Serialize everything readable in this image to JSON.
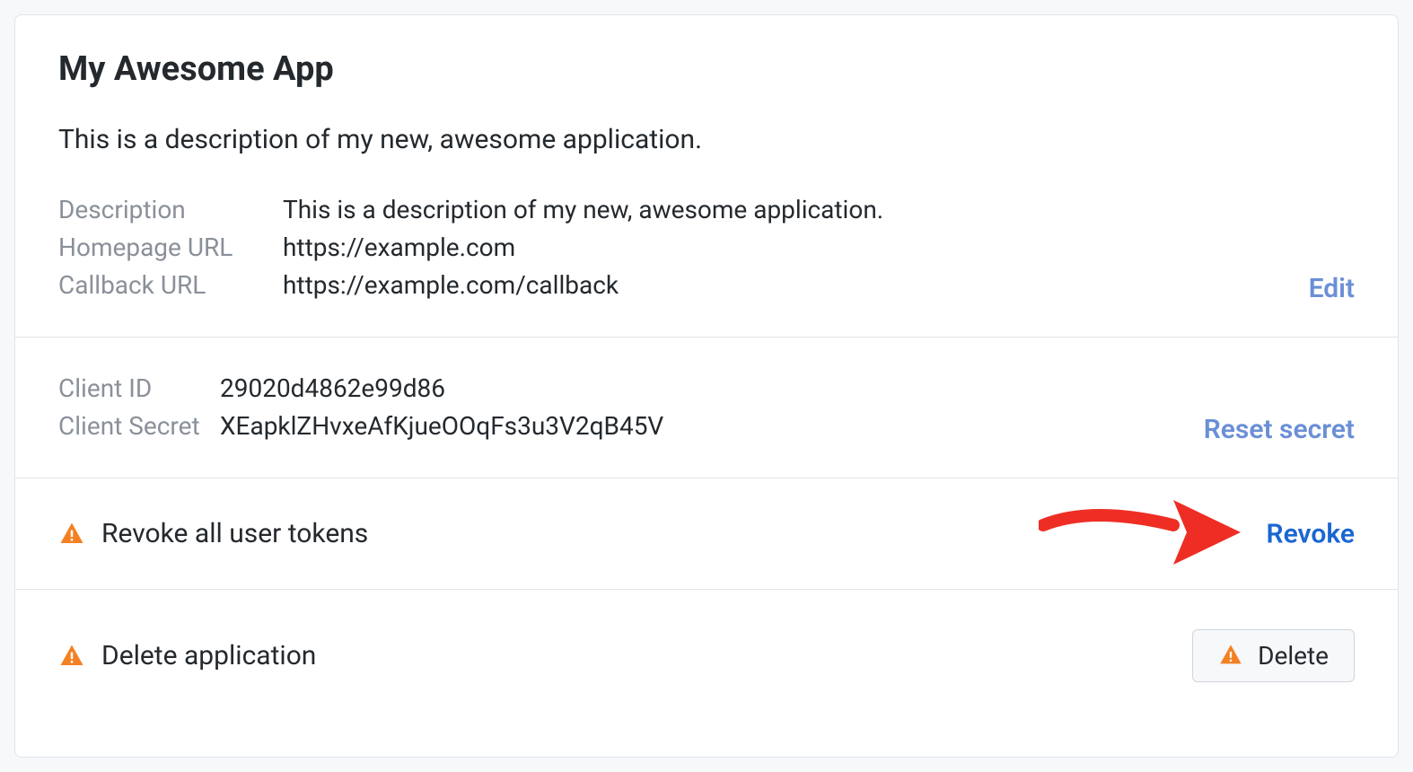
{
  "app": {
    "title": "My Awesome App",
    "description": "This is a description of my new, awesome application."
  },
  "details": {
    "description_label": "Description",
    "description_value": "This is a description of my new, awesome application.",
    "homepage_label": "Homepage URL",
    "homepage_value": "https://example.com",
    "callback_label": "Callback URL",
    "callback_value": "https://example.com/callback",
    "edit_label": "Edit"
  },
  "credentials": {
    "client_id_label": "Client ID",
    "client_id_value": "29020d4862e99d86",
    "client_secret_label": "Client Secret",
    "client_secret_value": "XEapklZHvxeAfKjueOOqFs3u3V2qB45V",
    "reset_label": "Reset secret"
  },
  "revoke": {
    "label": "Revoke all user tokens",
    "action_label": "Revoke"
  },
  "delete": {
    "label": "Delete application",
    "button_label": "Delete"
  },
  "colors": {
    "link_muted": "#6a8fd6",
    "link_primary": "#1a67d2",
    "warning": "#f48022",
    "annotation_arrow": "#ee2e24"
  },
  "icons": {
    "warning": "warning-triangle-icon"
  }
}
